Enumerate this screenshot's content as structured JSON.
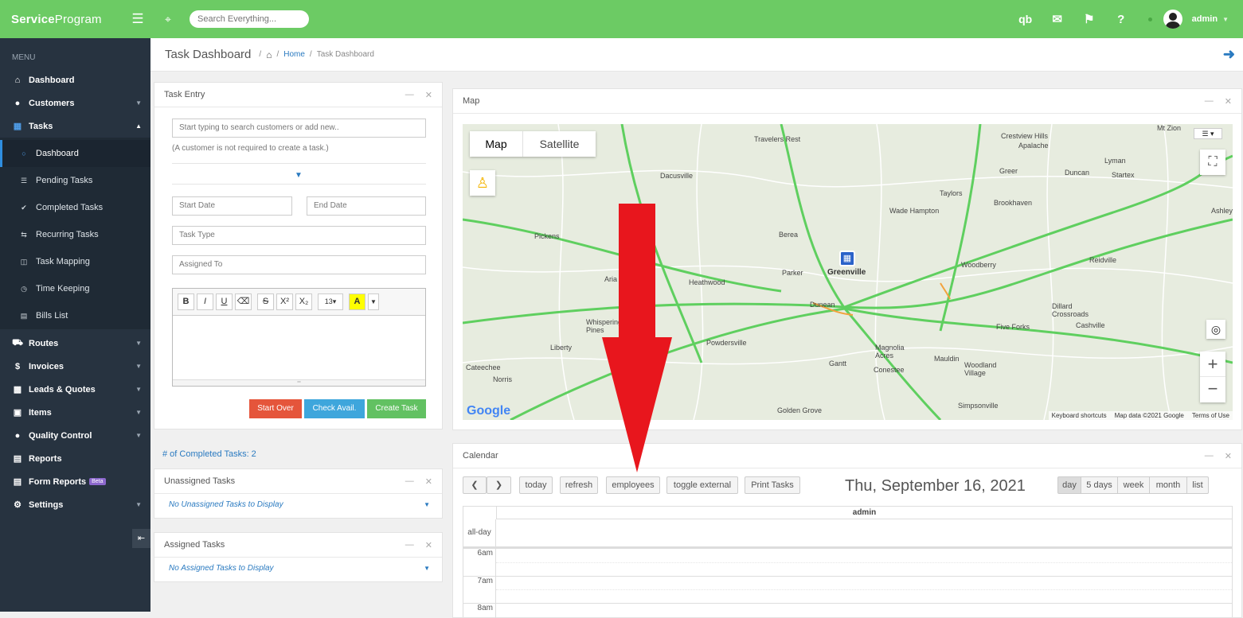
{
  "app": {
    "brand_bold": "Service",
    "brand_thin": "Program",
    "search_placeholder": "Search Everything...",
    "user": "admin"
  },
  "topbar_icons": [
    "hamburger-icon",
    "expand-icon",
    "quickbooks-icon",
    "mail-icon",
    "flag-icon",
    "help-icon"
  ],
  "sidebar": {
    "menu_label": "MENU",
    "items": [
      {
        "label": "Dashboard"
      },
      {
        "label": "Customers"
      },
      {
        "label": "Tasks"
      },
      {
        "label": "Routes"
      },
      {
        "label": "Invoices"
      },
      {
        "label": "Leads & Quotes"
      },
      {
        "label": "Items"
      },
      {
        "label": "Quality Control"
      },
      {
        "label": "Reports"
      },
      {
        "label": "Form Reports",
        "badge": "Beta"
      },
      {
        "label": "Settings"
      }
    ],
    "task_sub": [
      {
        "label": "Dashboard"
      },
      {
        "label": "Pending Tasks"
      },
      {
        "label": "Completed Tasks"
      },
      {
        "label": "Recurring Tasks"
      },
      {
        "label": "Task Mapping"
      },
      {
        "label": "Time Keeping"
      },
      {
        "label": "Bills List"
      }
    ]
  },
  "page": {
    "title": "Task Dashboard",
    "crumb_home": "Home",
    "crumb_current": "Task Dashboard"
  },
  "task_entry": {
    "title": "Task Entry",
    "customer_placeholder": "Start typing to search customers or add new..",
    "customer_hint": "(A customer is not required to create a task.)",
    "start_date": "Start Date",
    "end_date": "End Date",
    "task_type": "Task Type",
    "assigned_to": "Assigned To",
    "font_size": "13",
    "btn_start_over": "Start Over",
    "btn_check_avail": "Check Avail.",
    "btn_create": "Create Task",
    "colors": {
      "start_over": "#e5553b",
      "check_avail": "#3ea6dc",
      "create": "#62c162"
    }
  },
  "completed_count": "# of Completed Tasks: 2",
  "unassigned": {
    "title": "Unassigned Tasks",
    "empty": "No Unassigned Tasks to Display"
  },
  "assigned": {
    "title": "Assigned Tasks",
    "empty": "No Assigned Tasks to Display"
  },
  "map": {
    "title": "Map",
    "tab_map": "Map",
    "tab_satellite": "Satellite",
    "logo": "Google",
    "footer": [
      "Keyboard shortcuts",
      "Map data ©2021 Google",
      "Terms of Use"
    ],
    "places": [
      "Travelers Rest",
      "Dacusville",
      "Crestview Hills",
      "Apalache",
      "Mt Zion",
      "Lyman",
      "Greer",
      "Duncan",
      "Startex",
      "Taylors",
      "Wade Hampton",
      "Brookhaven",
      "Pickens",
      "Berea",
      "Greenville",
      "Parker",
      "Woodberry",
      "Reidville",
      "Heathwood",
      "Dunean",
      "Whispering Pines",
      "Powdersville",
      "Liberty",
      "Magnolia Acres",
      "Mauldin",
      "Five Forks",
      "Cashville",
      "Dillard Crossroads",
      "Gantt",
      "Conestee",
      "Woodland Village",
      "Cateechee",
      "Norris",
      "Golden Grove",
      "Simpsonville",
      "Ashley",
      "Aria"
    ]
  },
  "calendar": {
    "title": "Calendar",
    "btn_today": "today",
    "btn_refresh": "refresh",
    "btn_employees": "employees",
    "btn_toggle": "toggle external",
    "btn_print": "Print Tasks",
    "date": "Thu, September 16, 2021",
    "views": [
      "day",
      "5 days",
      "week",
      "month",
      "list"
    ],
    "resource": "admin",
    "allday": "all-day",
    "hours": [
      "6am",
      "7am",
      "8am"
    ]
  }
}
